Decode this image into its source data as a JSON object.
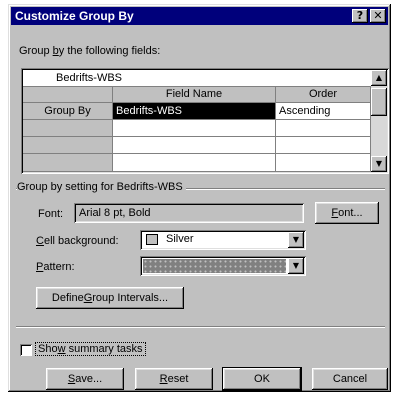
{
  "window": {
    "title": "Customize Group By",
    "help_glyph": "?",
    "close_glyph": "✕"
  },
  "group_fields": {
    "label_pre": "Group ",
    "label_ul": "b",
    "label_post": "y the following fields:",
    "top_row_value": "Bedrifts-WBS",
    "headers": {
      "field_name": "Field Name",
      "order": "Order"
    },
    "rows": [
      {
        "header": "Group By",
        "field_name": "Bedrifts-WBS",
        "order": "Ascending"
      },
      {
        "header": "",
        "field_name": "",
        "order": ""
      },
      {
        "header": "",
        "field_name": "",
        "order": ""
      },
      {
        "header": "",
        "field_name": "",
        "order": ""
      }
    ]
  },
  "setting": {
    "label": "Group by setting for Bedrifts-WBS",
    "font_label": "Font:",
    "font_value": "Arial 8 pt, Bold",
    "font_button_ul": "F",
    "font_button_rest": "ont...",
    "cell_bg_label_ul": "C",
    "cell_bg_label_rest": "ell background:",
    "cell_bg_value": "Silver",
    "cell_bg_color": "#c0c0c0",
    "pattern_label_ul": "P",
    "pattern_label_rest": "attern:",
    "intervals_button_pre": "Define ",
    "intervals_button_ul": "G",
    "intervals_button_post": "roup Intervals..."
  },
  "summary": {
    "label_pre": "Sho",
    "label_ul": "w",
    "label_post": " summary tasks",
    "checked": false
  },
  "buttons": {
    "save_ul": "S",
    "save_rest": "ave...",
    "reset_ul": "R",
    "reset_rest": "eset",
    "ok": "OK",
    "cancel": "Cancel"
  },
  "colors": {
    "titlebar": "#00007b",
    "face": "#c0c0c0",
    "selection": "#000000"
  }
}
